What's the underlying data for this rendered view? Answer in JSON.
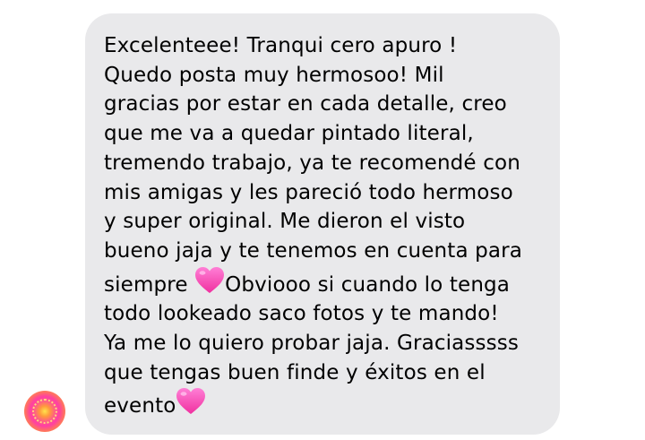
{
  "conversation": {
    "message": {
      "lines": [
        "Excelenteee! Tranqui cero apuro !",
        "Quedo posta muy hermosoo! Mil",
        "gracias por estar en cada detalle, creo",
        "que me va a quedar pintado literal,",
        "tremendo trabajo, ya te recomendé con",
        "mis amigas y les pareció todo hermoso",
        "y super original. Me dieron el visto",
        "bueno jaja y te tenemos en cuenta para",
        "siempre ",
        "Obviooo si cuando lo tenga",
        "todo lookeado saco fotos y te mando!",
        "Ya me lo quiero probar jaja. Graciasssss",
        "que tengas buen finde y éxitos en el",
        "evento"
      ],
      "emoji": "pink-heart-icon"
    },
    "sender_avatar": "avatar-icon",
    "colors": {
      "bubble_bg": "#e9e9eb",
      "text": "#000000",
      "heart": "#ff4fbf"
    }
  }
}
